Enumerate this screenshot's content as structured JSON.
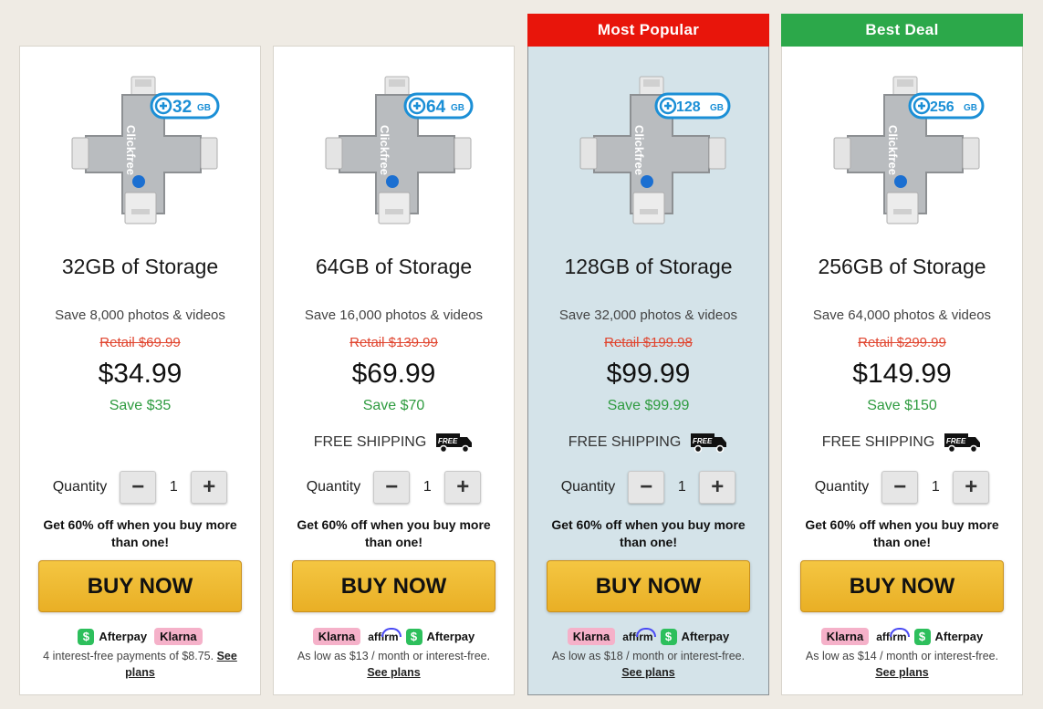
{
  "cards": [
    {
      "badge_value": "32",
      "badge_unit": "GB",
      "title": "32GB of Storage",
      "subtitle": "Save 8,000 photos & videos",
      "retail": "Retail $69.99",
      "price": "$34.99",
      "save": "Save $35",
      "quantity_label": "Quantity",
      "quantity": "1",
      "promo": "Get 60% off when you buy more than one!",
      "buy_label": "BUY NOW",
      "afterpay": "Afterpay",
      "klarna": "Klarna",
      "pay_text": "4 interest-free payments of $8.75.",
      "see_plans": "See plans"
    },
    {
      "badge_value": "64",
      "badge_unit": "GB",
      "title": "64GB of Storage",
      "subtitle": "Save 16,000 photos & videos",
      "retail": "Retail $139.99",
      "price": "$69.99",
      "save": "Save $70",
      "shipping": "FREE SHIPPING",
      "quantity_label": "Quantity",
      "quantity": "1",
      "promo": "Get 60% off when you buy more than one!",
      "buy_label": "BUY NOW",
      "klarna": "Klarna",
      "affirm": "affirm",
      "afterpay": "Afterpay",
      "pay_text": "As low as $13 / month or interest-free.",
      "see_plans": "See plans"
    },
    {
      "ribbon": "Most Popular",
      "badge_value": "128",
      "badge_unit": "GB",
      "title": "128GB of Storage",
      "subtitle": "Save 32,000 photos & videos",
      "retail": "Retail $199.98",
      "price": "$99.99",
      "save": "Save $99.99",
      "shipping": "FREE SHIPPING",
      "quantity_label": "Quantity",
      "quantity": "1",
      "promo": "Get 60% off when you buy more than one!",
      "buy_label": "BUY NOW",
      "klarna": "Klarna",
      "affirm": "affirm",
      "afterpay": "Afterpay",
      "pay_text": "As low as $18 / month or interest-free.",
      "see_plans": "See plans"
    },
    {
      "ribbon": "Best Deal",
      "badge_value": "256",
      "badge_unit": "GB",
      "title": "256GB of Storage",
      "subtitle": "Save 64,000 photos & videos",
      "retail": "Retail $299.99",
      "price": "$149.99",
      "save": "Save $150",
      "shipping": "FREE SHIPPING",
      "quantity_label": "Quantity",
      "quantity": "1",
      "promo": "Get 60% off when you buy more than one!",
      "buy_label": "BUY NOW",
      "klarna": "Klarna",
      "affirm": "affirm",
      "afterpay": "Afterpay",
      "pay_text": "As low as $14 / month or interest-free.",
      "see_plans": "See plans"
    }
  ],
  "product_brand": "Clickfree",
  "truck_text": "FREE",
  "qty_minus": "−",
  "qty_plus": "+",
  "afterpay_icon_glyph": "$",
  "colors": {
    "ribbon_most_popular": "#e8150b",
    "ribbon_best_deal": "#2ca84a",
    "price_save_green": "#2e9b3f",
    "retail_red": "#e0452f",
    "buy_gold": "#f0bb34",
    "highlight_bg": "#d4e3e9",
    "badge_blue": "#1b8fd6"
  },
  "icons": [
    "usb-drive-image",
    "truck-icon",
    "afterpay-icon",
    "klarna-logo",
    "affirm-logo"
  ]
}
